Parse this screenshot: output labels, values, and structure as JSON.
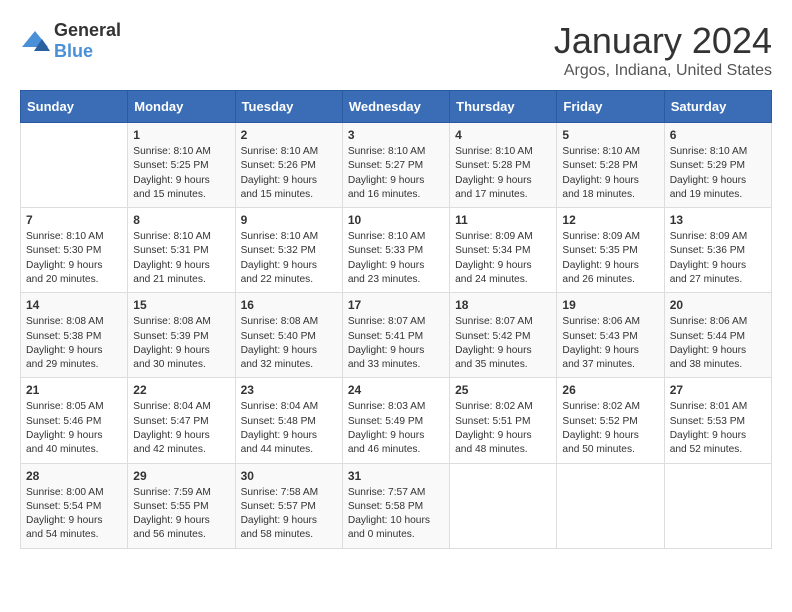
{
  "logo": {
    "general": "General",
    "blue": "Blue"
  },
  "title": "January 2024",
  "location": "Argos, Indiana, United States",
  "weekdays": [
    "Sunday",
    "Monday",
    "Tuesday",
    "Wednesday",
    "Thursday",
    "Friday",
    "Saturday"
  ],
  "weeks": [
    [
      {
        "day": "",
        "info": ""
      },
      {
        "day": "1",
        "info": "Sunrise: 8:10 AM\nSunset: 5:25 PM\nDaylight: 9 hours\nand 15 minutes."
      },
      {
        "day": "2",
        "info": "Sunrise: 8:10 AM\nSunset: 5:26 PM\nDaylight: 9 hours\nand 15 minutes."
      },
      {
        "day": "3",
        "info": "Sunrise: 8:10 AM\nSunset: 5:27 PM\nDaylight: 9 hours\nand 16 minutes."
      },
      {
        "day": "4",
        "info": "Sunrise: 8:10 AM\nSunset: 5:28 PM\nDaylight: 9 hours\nand 17 minutes."
      },
      {
        "day": "5",
        "info": "Sunrise: 8:10 AM\nSunset: 5:28 PM\nDaylight: 9 hours\nand 18 minutes."
      },
      {
        "day": "6",
        "info": "Sunrise: 8:10 AM\nSunset: 5:29 PM\nDaylight: 9 hours\nand 19 minutes."
      }
    ],
    [
      {
        "day": "7",
        "info": "Sunrise: 8:10 AM\nSunset: 5:30 PM\nDaylight: 9 hours\nand 20 minutes."
      },
      {
        "day": "8",
        "info": "Sunrise: 8:10 AM\nSunset: 5:31 PM\nDaylight: 9 hours\nand 21 minutes."
      },
      {
        "day": "9",
        "info": "Sunrise: 8:10 AM\nSunset: 5:32 PM\nDaylight: 9 hours\nand 22 minutes."
      },
      {
        "day": "10",
        "info": "Sunrise: 8:10 AM\nSunset: 5:33 PM\nDaylight: 9 hours\nand 23 minutes."
      },
      {
        "day": "11",
        "info": "Sunrise: 8:09 AM\nSunset: 5:34 PM\nDaylight: 9 hours\nand 24 minutes."
      },
      {
        "day": "12",
        "info": "Sunrise: 8:09 AM\nSunset: 5:35 PM\nDaylight: 9 hours\nand 26 minutes."
      },
      {
        "day": "13",
        "info": "Sunrise: 8:09 AM\nSunset: 5:36 PM\nDaylight: 9 hours\nand 27 minutes."
      }
    ],
    [
      {
        "day": "14",
        "info": "Sunrise: 8:08 AM\nSunset: 5:38 PM\nDaylight: 9 hours\nand 29 minutes."
      },
      {
        "day": "15",
        "info": "Sunrise: 8:08 AM\nSunset: 5:39 PM\nDaylight: 9 hours\nand 30 minutes."
      },
      {
        "day": "16",
        "info": "Sunrise: 8:08 AM\nSunset: 5:40 PM\nDaylight: 9 hours\nand 32 minutes."
      },
      {
        "day": "17",
        "info": "Sunrise: 8:07 AM\nSunset: 5:41 PM\nDaylight: 9 hours\nand 33 minutes."
      },
      {
        "day": "18",
        "info": "Sunrise: 8:07 AM\nSunset: 5:42 PM\nDaylight: 9 hours\nand 35 minutes."
      },
      {
        "day": "19",
        "info": "Sunrise: 8:06 AM\nSunset: 5:43 PM\nDaylight: 9 hours\nand 37 minutes."
      },
      {
        "day": "20",
        "info": "Sunrise: 8:06 AM\nSunset: 5:44 PM\nDaylight: 9 hours\nand 38 minutes."
      }
    ],
    [
      {
        "day": "21",
        "info": "Sunrise: 8:05 AM\nSunset: 5:46 PM\nDaylight: 9 hours\nand 40 minutes."
      },
      {
        "day": "22",
        "info": "Sunrise: 8:04 AM\nSunset: 5:47 PM\nDaylight: 9 hours\nand 42 minutes."
      },
      {
        "day": "23",
        "info": "Sunrise: 8:04 AM\nSunset: 5:48 PM\nDaylight: 9 hours\nand 44 minutes."
      },
      {
        "day": "24",
        "info": "Sunrise: 8:03 AM\nSunset: 5:49 PM\nDaylight: 9 hours\nand 46 minutes."
      },
      {
        "day": "25",
        "info": "Sunrise: 8:02 AM\nSunset: 5:51 PM\nDaylight: 9 hours\nand 48 minutes."
      },
      {
        "day": "26",
        "info": "Sunrise: 8:02 AM\nSunset: 5:52 PM\nDaylight: 9 hours\nand 50 minutes."
      },
      {
        "day": "27",
        "info": "Sunrise: 8:01 AM\nSunset: 5:53 PM\nDaylight: 9 hours\nand 52 minutes."
      }
    ],
    [
      {
        "day": "28",
        "info": "Sunrise: 8:00 AM\nSunset: 5:54 PM\nDaylight: 9 hours\nand 54 minutes."
      },
      {
        "day": "29",
        "info": "Sunrise: 7:59 AM\nSunset: 5:55 PM\nDaylight: 9 hours\nand 56 minutes."
      },
      {
        "day": "30",
        "info": "Sunrise: 7:58 AM\nSunset: 5:57 PM\nDaylight: 9 hours\nand 58 minutes."
      },
      {
        "day": "31",
        "info": "Sunrise: 7:57 AM\nSunset: 5:58 PM\nDaylight: 10 hours\nand 0 minutes."
      },
      {
        "day": "",
        "info": ""
      },
      {
        "day": "",
        "info": ""
      },
      {
        "day": "",
        "info": ""
      }
    ]
  ]
}
